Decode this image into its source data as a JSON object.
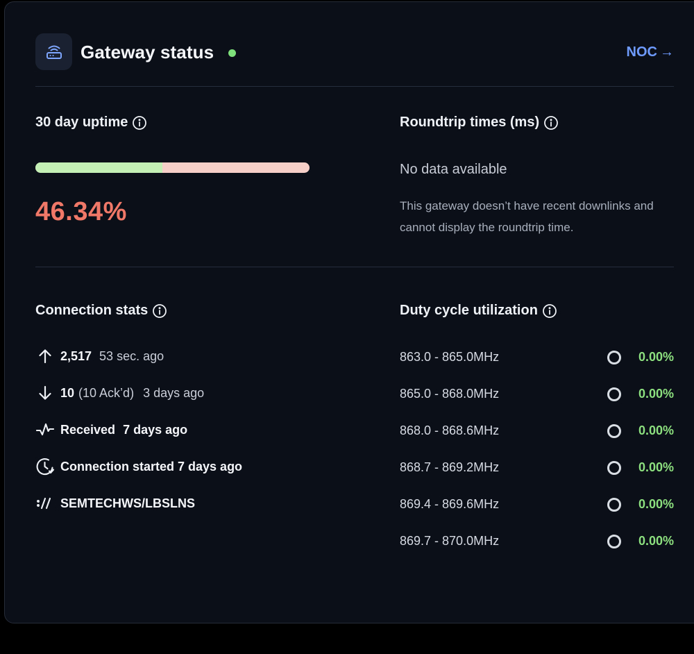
{
  "header": {
    "title": "Gateway status",
    "status_color": "#7ee07a",
    "noc_label": "NOC",
    "noc_arrow": "→"
  },
  "uptime": {
    "title": "30 day uptime",
    "value_label": "46.34%",
    "fraction": 0.4634,
    "up_color": "#c4f0b5",
    "down_color": "#f7cfc9",
    "value_color": "#f07868"
  },
  "roundtrip": {
    "title": "Roundtrip times (ms)",
    "no_data": "No data available",
    "description": "This gateway doesn’t have recent downlinks and cannot display the roundtrip time."
  },
  "connection": {
    "title": "Connection stats",
    "uplink": {
      "icon": "arrow-up-icon",
      "count": "2,517",
      "time": "53 sec. ago"
    },
    "downlink": {
      "icon": "arrow-down-icon",
      "count": "10",
      "acked": "(10 Ack’d)",
      "time": "3 days ago"
    },
    "received": {
      "icon": "activity-icon",
      "label": "Received",
      "time": "7 days ago"
    },
    "started": {
      "icon": "clock-icon",
      "label": "Connection started 7 days ago"
    },
    "protocol": {
      "icon": "protocol-icon",
      "label": "SEMTECHWS/LBSLNS"
    }
  },
  "duty_cycle": {
    "title": "Duty cycle utilization",
    "bands": [
      {
        "band": "863.0 - 865.0MHz",
        "value": "0.00%"
      },
      {
        "band": "865.0 - 868.0MHz",
        "value": "0.00%"
      },
      {
        "band": "868.0 - 868.6MHz",
        "value": "0.00%"
      },
      {
        "band": "868.7 - 869.2MHz",
        "value": "0.00%"
      },
      {
        "band": "869.4 - 869.6MHz",
        "value": "0.00%"
      },
      {
        "band": "869.7 - 870.0MHz",
        "value": "0.00%"
      }
    ]
  }
}
